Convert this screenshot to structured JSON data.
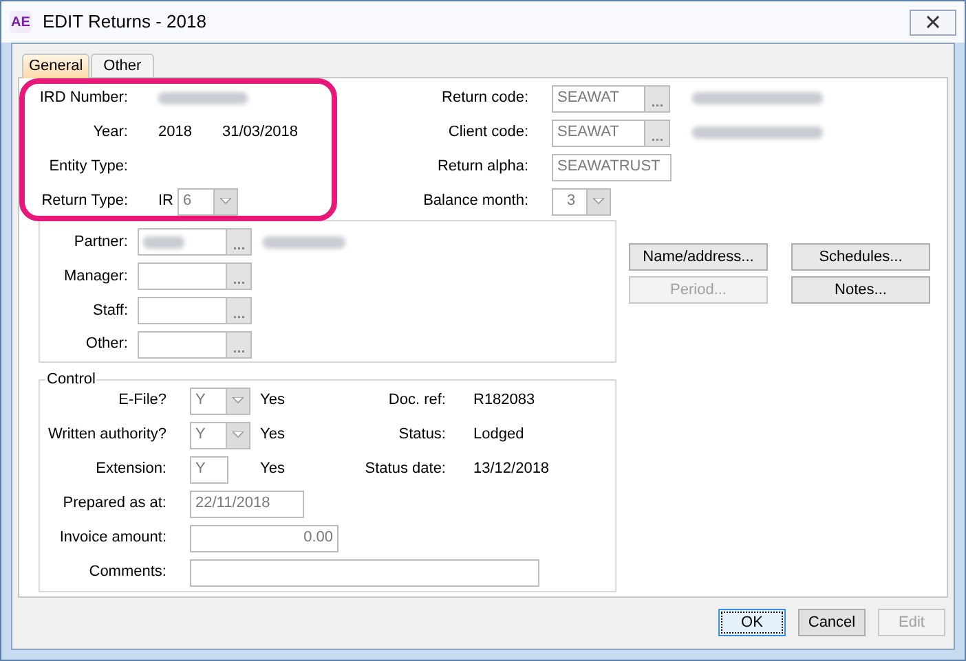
{
  "window": {
    "title": "EDIT Returns - 2018",
    "app_icon": "AE"
  },
  "tabs": [
    {
      "label": "General",
      "selected": true
    },
    {
      "label": "Other",
      "selected": false
    }
  ],
  "header_left": [
    {
      "label": "IRD Number:",
      "kind": "redacted"
    },
    {
      "label": "Year:",
      "kind": "values",
      "values": [
        "2018",
        "31/03/2018"
      ]
    },
    {
      "label": "Entity Type:",
      "kind": "empty"
    },
    {
      "label": "Return Type:",
      "kind": "combo",
      "prefix": "IR",
      "value": "6"
    }
  ],
  "header_right": [
    {
      "label": "Return code:",
      "kind": "lookup",
      "value": "SEAWAT",
      "redacted_name": true
    },
    {
      "label": "Client code:",
      "kind": "lookup",
      "value": "SEAWAT",
      "redacted_name": true
    },
    {
      "label": "Return alpha:",
      "kind": "text",
      "value": "SEAWATRUST",
      "redacted_name": false
    },
    {
      "label": "Balance month:",
      "kind": "combo",
      "value": "3",
      "redacted_name": false
    }
  ],
  "staff": [
    {
      "label": "Partner:",
      "redacted": true
    },
    {
      "label": "Manager:",
      "redacted": false
    },
    {
      "label": "Staff:",
      "redacted": false
    },
    {
      "label": "Other:",
      "redacted": false
    }
  ],
  "side_buttons": [
    {
      "label": "Name/address...",
      "disabled": false
    },
    {
      "label": "Schedules...",
      "disabled": false
    },
    {
      "label": "Period...",
      "disabled": true
    },
    {
      "label": "Notes...",
      "disabled": false
    }
  ],
  "control": {
    "title": "Control",
    "left": [
      {
        "label": "E-File?",
        "kind": "combo",
        "value": "Y",
        "note": "Yes"
      },
      {
        "label": "Written authority?",
        "kind": "combo",
        "value": "Y",
        "note": "Yes"
      },
      {
        "label": "Extension:",
        "kind": "short",
        "value": "Y",
        "note": "Yes"
      },
      {
        "label": "Prepared as at:",
        "kind": "date",
        "value": "22/11/2018"
      },
      {
        "label": "Invoice amount:",
        "kind": "amount",
        "value": "0.00"
      },
      {
        "label": "Comments:",
        "kind": "memo"
      }
    ],
    "right": [
      {
        "label": "Doc. ref:",
        "value": "R182083"
      },
      {
        "label": "Status:",
        "value": "Lodged"
      },
      {
        "label": "Status date:",
        "value": "13/12/2018"
      }
    ]
  },
  "buttons": [
    {
      "label": "OK",
      "default": true,
      "disabled": false
    },
    {
      "label": "Cancel",
      "default": false,
      "disabled": false
    },
    {
      "label": "Edit",
      "default": false,
      "disabled": true
    }
  ],
  "annotations": [
    {
      "kind": "highlight_box"
    }
  ]
}
